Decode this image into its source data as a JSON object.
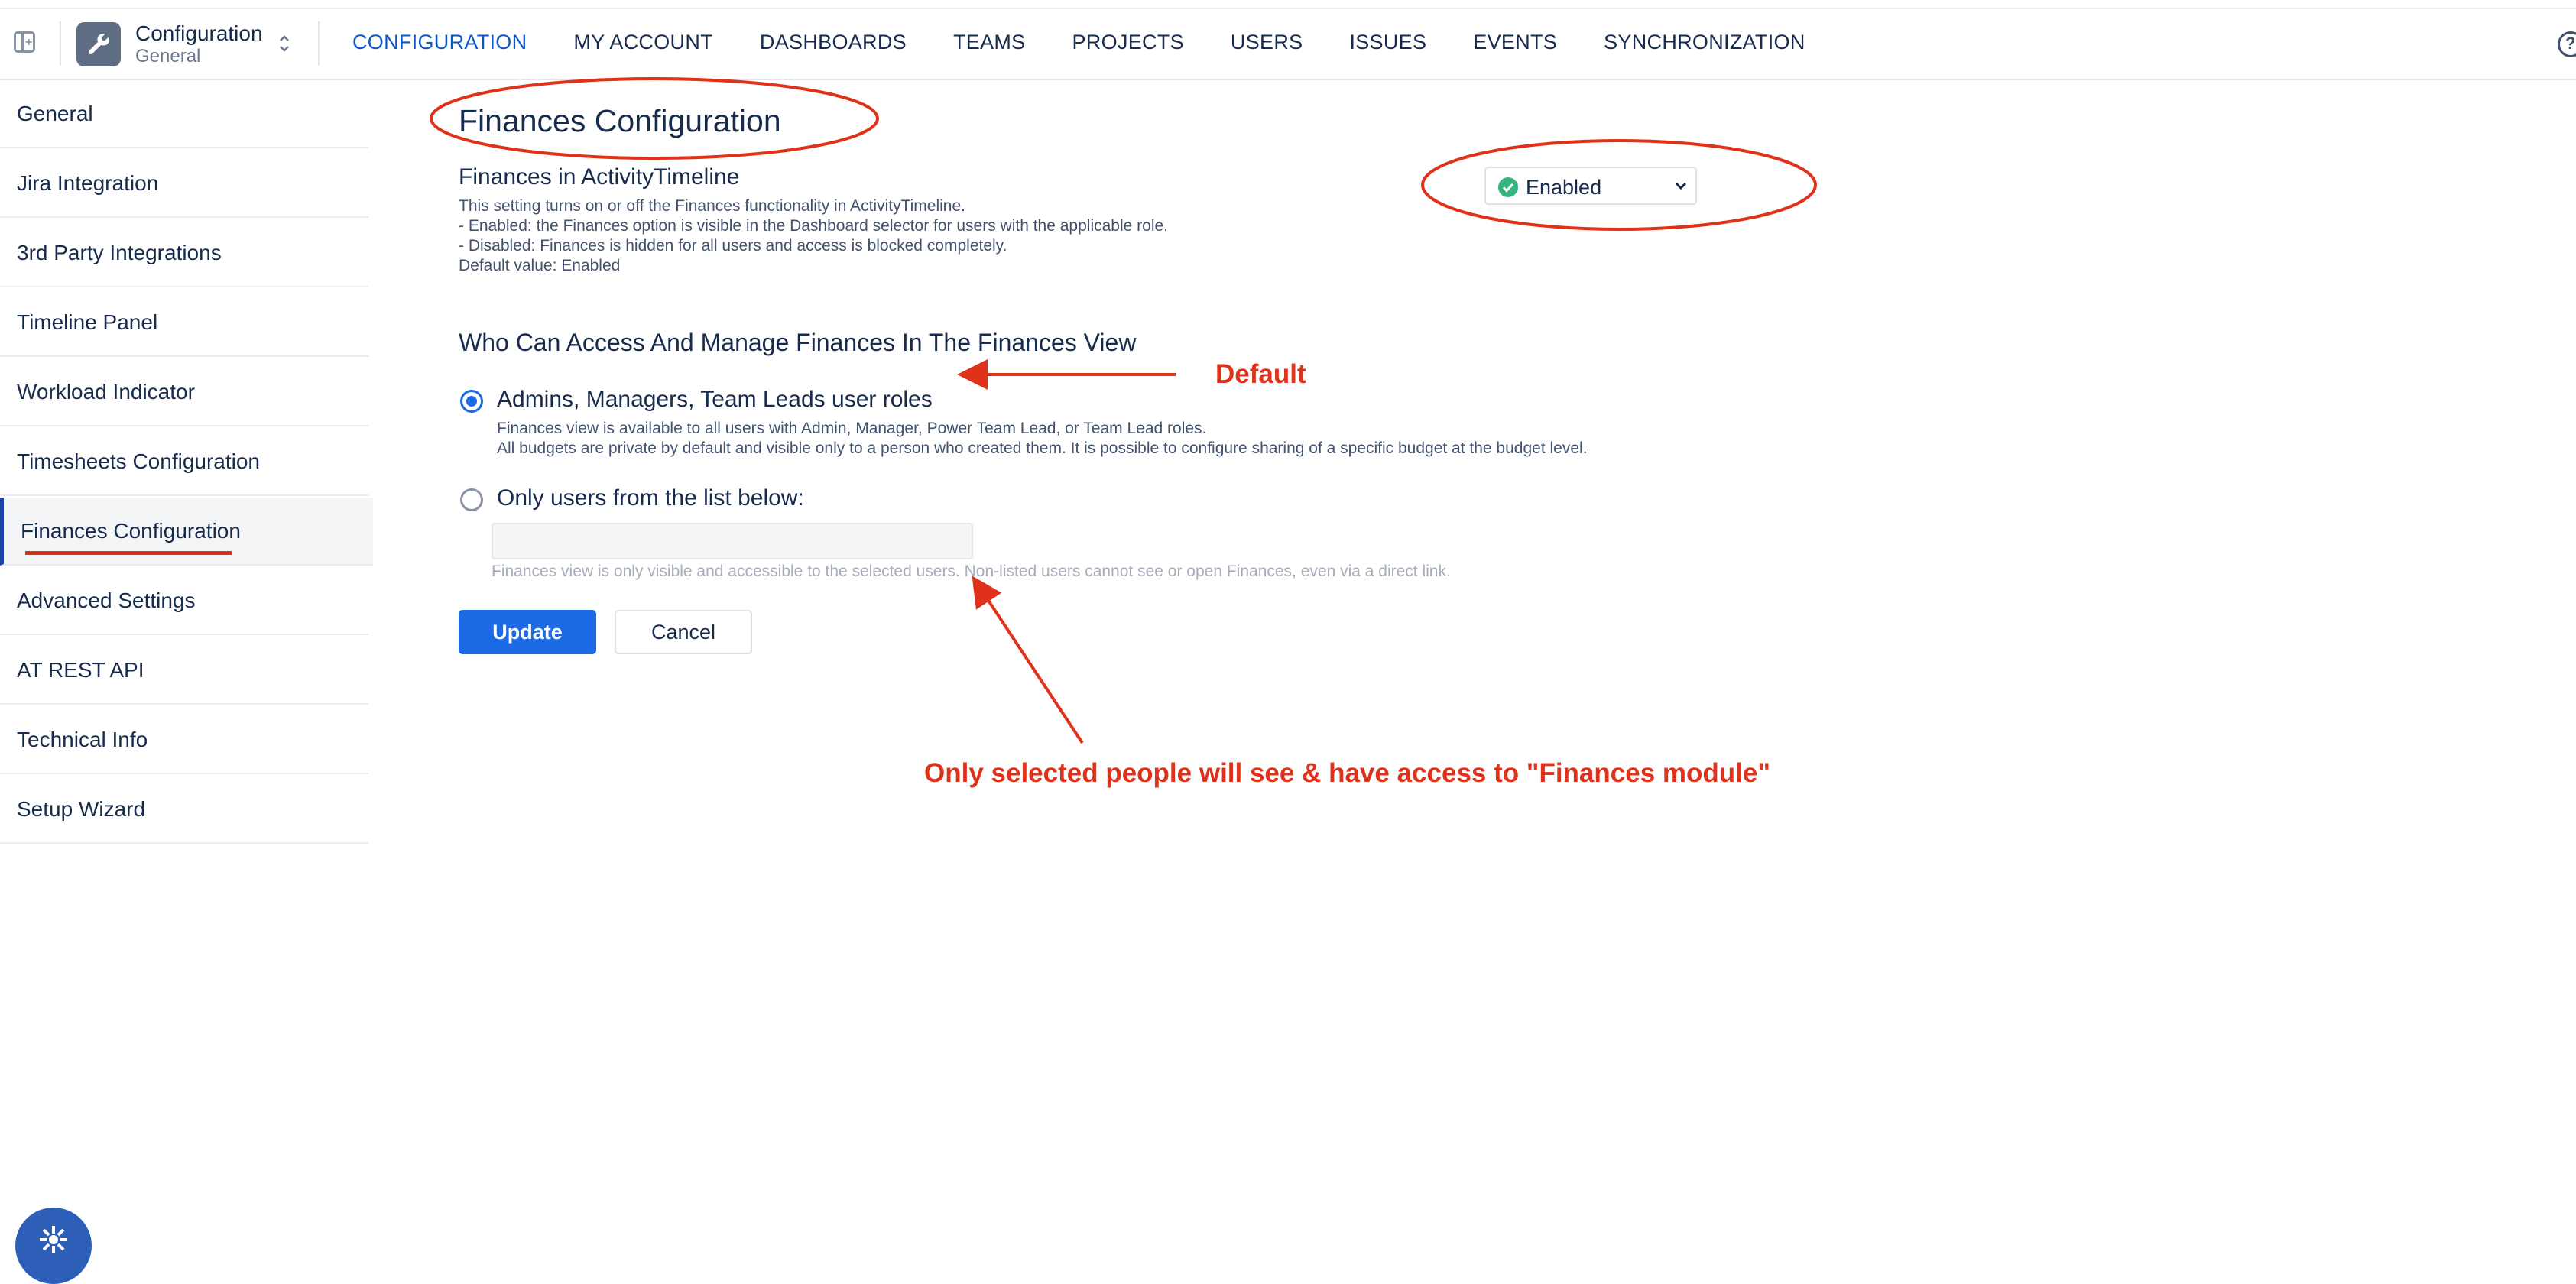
{
  "header": {
    "app_title": "Configuration",
    "app_subtitle": "General",
    "tabs": [
      {
        "label": "CONFIGURATION",
        "active": true
      },
      {
        "label": "MY ACCOUNT"
      },
      {
        "label": "DASHBOARDS"
      },
      {
        "label": "TEAMS"
      },
      {
        "label": "PROJECTS"
      },
      {
        "label": "USERS"
      },
      {
        "label": "ISSUES"
      },
      {
        "label": "EVENTS"
      },
      {
        "label": "SYNCHRONIZATION"
      }
    ]
  },
  "sidebar": {
    "items": [
      {
        "label": "General"
      },
      {
        "label": "Jira Integration"
      },
      {
        "label": "3rd Party Integrations"
      },
      {
        "label": "Timeline Panel"
      },
      {
        "label": "Workload Indicator"
      },
      {
        "label": "Timesheets Configuration"
      },
      {
        "label": "Finances Configuration",
        "active": true
      },
      {
        "label": "Advanced Settings"
      },
      {
        "label": "AT REST API"
      },
      {
        "label": "Technical Info"
      },
      {
        "label": "Setup Wizard"
      }
    ]
  },
  "main": {
    "page_title": "Finances Configuration",
    "setting_title": "Finances in ActivityTimeline",
    "setting_desc": [
      "This setting turns on or off the Finances functionality in ActivityTimeline.",
      "- Enabled: the Finances option is visible in the Dashboard selector for users with the applicable role.",
      "- Disabled: Finances is hidden for all users and access is blocked completely.",
      "Default value: Enabled"
    ],
    "status_select": {
      "value": "Enabled",
      "color": "#36b37e"
    },
    "section_title": "Who Can Access And Manage Finances In The Finances View",
    "option_roles": {
      "label": "Admins, Managers, Team Leads user roles",
      "checked": true,
      "desc": [
        "Finances view is available to all users with Admin, Manager, Power Team Lead, or Team Lead roles.",
        "All budgets are private by default and visible only to a person who created them. It is possible to configure sharing of a specific budget at the budget level."
      ]
    },
    "option_list": {
      "label": "Only users from the list below:",
      "checked": false,
      "hint": "Finances view is only visible and accessible to the selected users. Non-listed users cannot see or open Finances, even via a direct link."
    },
    "update_label": "Update",
    "cancel_label": "Cancel"
  },
  "annotations": {
    "default_label": "Default",
    "access_note": "Only selected people will see & have access to \"Finances module\"",
    "color": "#e0311a"
  },
  "colors": {
    "accent": "#1d6ae5",
    "active_tab": "#0c57c7",
    "text": "#172b4d"
  }
}
